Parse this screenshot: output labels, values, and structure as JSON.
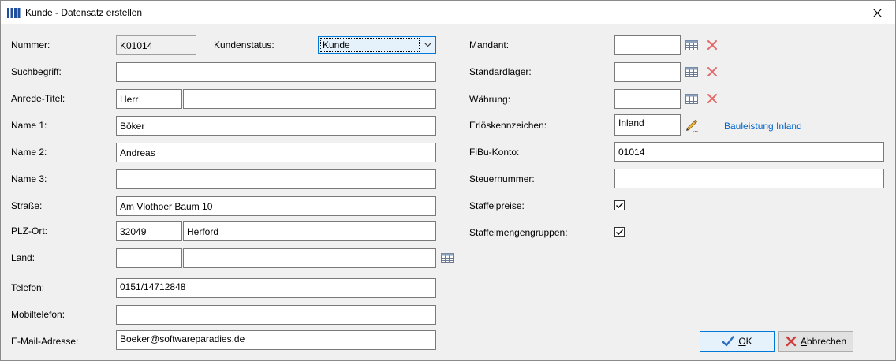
{
  "window": {
    "title": "Kunde - Datensatz erstellen"
  },
  "left": {
    "nummer": {
      "label": "Nummer:",
      "value": "K01014"
    },
    "kundenstatus": {
      "label": "Kundenstatus:",
      "value": "Kunde"
    },
    "suchbegriff": {
      "label": "Suchbegriff:",
      "value": ""
    },
    "anrede": {
      "label": "Anrede-Titel:",
      "anrede": "Herr",
      "titel": ""
    },
    "name1": {
      "label": "Name 1:",
      "value": "Böker"
    },
    "name2": {
      "label": "Name 2:",
      "value": "Andreas"
    },
    "name3": {
      "label": "Name 3:",
      "value": ""
    },
    "strasse": {
      "label": "Straße:",
      "value": "Am Vlothoer Baum 10"
    },
    "plz_ort": {
      "label": "PLZ-Ort:",
      "plz": "32049",
      "ort": "Herford"
    },
    "land": {
      "label": "Land:",
      "code": "",
      "name": ""
    },
    "telefon": {
      "label": "Telefon:",
      "value": "0151/14712848"
    },
    "mobil": {
      "label": "Mobiltelefon:",
      "value": ""
    },
    "email": {
      "label": "E-Mail-Adresse:",
      "value": "Boeker@softwareparadies.de"
    }
  },
  "right": {
    "mandant": {
      "label": "Mandant:",
      "value": ""
    },
    "standardlager": {
      "label": "Standardlager:",
      "value": ""
    },
    "waehrung": {
      "label": "Währung:",
      "value": ""
    },
    "erloes": {
      "label": "Erlöskennzeichen:",
      "value": "Inland",
      "link": "Bauleistung Inland"
    },
    "fibu": {
      "label": "FiBu-Konto:",
      "value": "01014"
    },
    "steuernummer": {
      "label": "Steuernummer:",
      "value": ""
    },
    "staffelpreise": {
      "label": "Staffelpreise:",
      "checked": true
    },
    "staffelmengen": {
      "label": "Staffelmengengruppen:",
      "checked": true
    }
  },
  "buttons": {
    "ok_mnemonic": "O",
    "ok_rest": "K",
    "cancel_mnemonic": "A",
    "cancel_rest": "bbrechen"
  },
  "colors": {
    "accent": "#0078d7",
    "link": "#0066cc",
    "delete_icon": "#e36a6a"
  },
  "icons": [
    "app-icon",
    "close-icon",
    "table-picker-icon",
    "delete-x-icon",
    "pencil-icon",
    "checkmark-icon",
    "chevron-down-icon"
  ]
}
